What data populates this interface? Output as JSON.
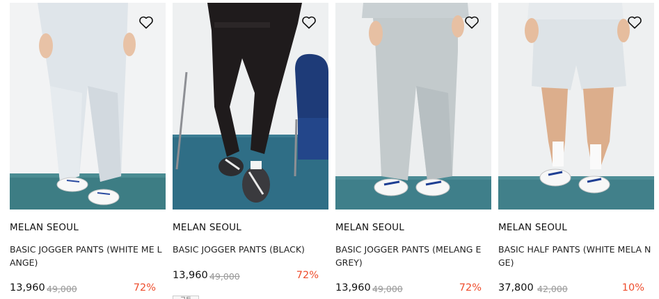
{
  "products": [
    {
      "brand": "MELAN SEOUL",
      "name": "BASIC JOGGER PANTS (WHITE ME LANGE)",
      "price": "13,960",
      "original_price": "49,000",
      "discount": "72%",
      "wishlist_icon": "heart-outline-icon",
      "wishlisted": false
    },
    {
      "brand": "MELAN SEOUL",
      "name": "BASIC JOGGER PANTS (BLACK)",
      "price": "13,960",
      "original_price": "49,000",
      "discount": "72%",
      "wishlist_icon": "heart-outline-icon",
      "wishlisted": false,
      "tag": "구두"
    },
    {
      "brand": "MELAN SEOUL",
      "name": "BASIC JOGGER PANTS (MELANG E GREY)",
      "price": "13,960",
      "original_price": "49,000",
      "discount": "72%",
      "wishlist_icon": "heart-outline-icon",
      "wishlisted": false
    },
    {
      "brand": "MELAN SEOUL",
      "name": "BASIC HALF PANTS (WHITE MELA NGE)",
      "price": "37,800",
      "original_price": "42,000",
      "discount": "10%",
      "wishlist_icon": "heart-outline-icon",
      "wishlisted": false
    }
  ],
  "colors": {
    "discount": "#ee4d2d",
    "original_price": "#999999",
    "text": "#111111"
  }
}
